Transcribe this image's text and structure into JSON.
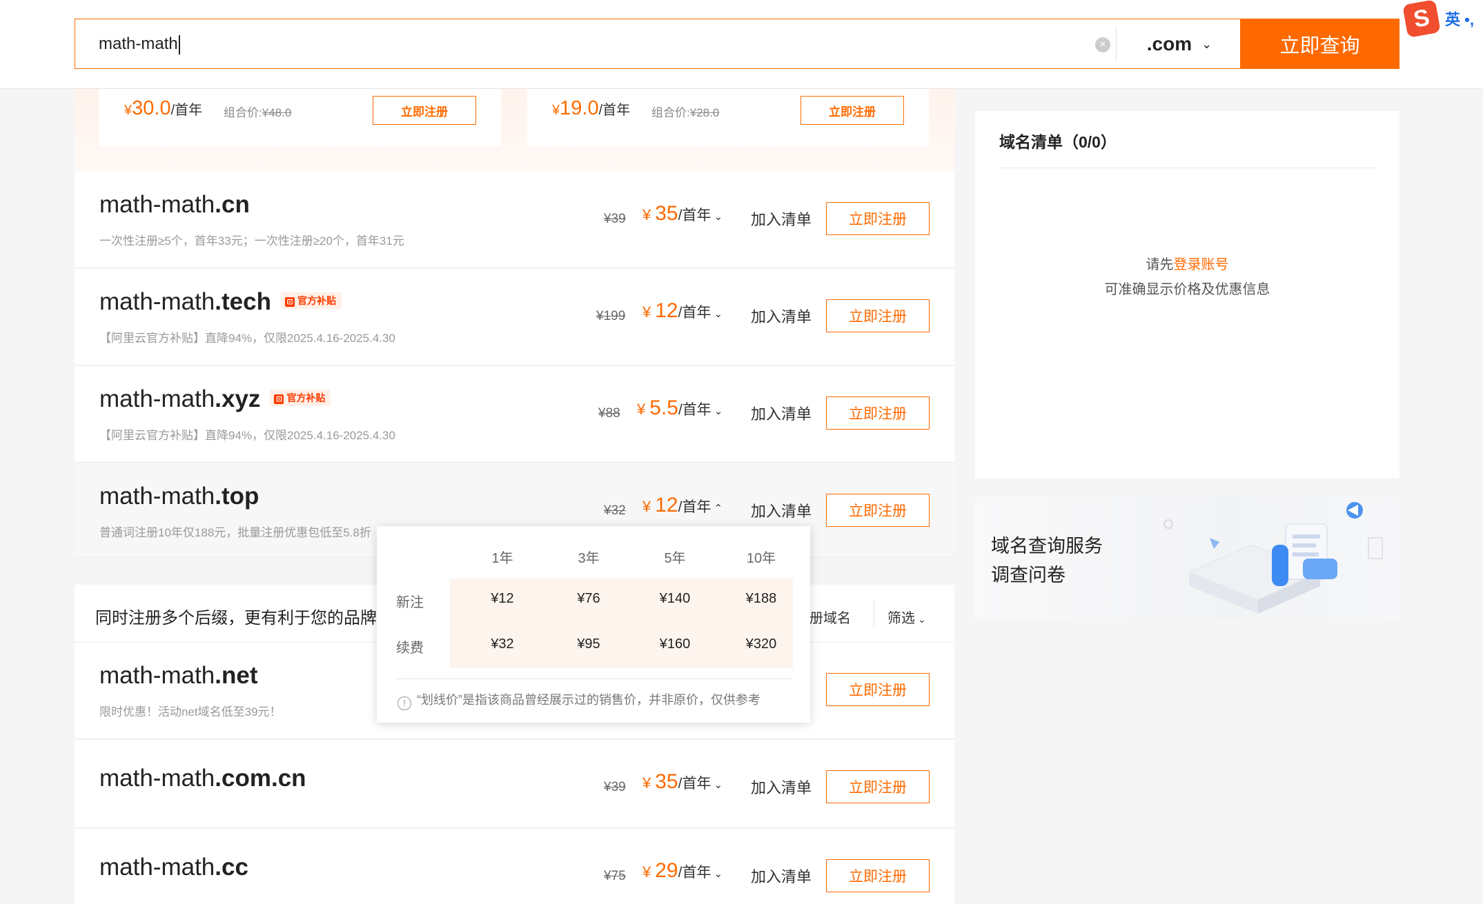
{
  "search": {
    "query": "math-math",
    "tld": ".com",
    "submit_label": "立即查询"
  },
  "ime": {
    "logo": "S",
    "mode": "英 •,"
  },
  "promo": [
    {
      "price_symbol": "¥",
      "price": "30.0",
      "unit": "/首年",
      "combo_label": "组合价:",
      "combo_orig": "¥48.0",
      "button": "立即注册"
    },
    {
      "price_symbol": "¥",
      "price": "19.0",
      "unit": "/首年",
      "combo_label": "组合价:",
      "combo_orig": "¥28.0",
      "button": "立即注册"
    }
  ],
  "domains": [
    {
      "base": "math-math",
      "tld": ".cn",
      "badge": "",
      "desc": "一次性注册≥5个，首年33元；一次性注册≥20个，首年31元",
      "orig_price": "¥39",
      "price_symbol": "¥",
      "price": "35",
      "unit": "/首年",
      "chevron": "⌄",
      "add_label": "加入清单",
      "register_label": "立即注册"
    },
    {
      "base": "math-math",
      "tld": ".tech",
      "badge": "官方补贴",
      "desc": "【阿里云官方补贴】直降94%，仅限2025.4.16-2025.4.30",
      "orig_price": "¥199",
      "price_symbol": "¥",
      "price": "12",
      "unit": "/首年",
      "chevron": "⌄",
      "add_label": "加入清单",
      "register_label": "立即注册"
    },
    {
      "base": "math-math",
      "tld": ".xyz",
      "badge": "官方补贴",
      "desc": "【阿里云官方补贴】直降94%，仅限2025.4.16-2025.4.30",
      "orig_price": "¥88",
      "price_symbol": "¥",
      "price": "5.5",
      "unit": "/首年",
      "chevron": "⌄",
      "add_label": "加入清单",
      "register_label": "立即注册"
    },
    {
      "base": "math-math",
      "tld": ".top",
      "badge": "",
      "desc": "普通词注册10年仅188元，批量注册优惠包低至5.8折",
      "orig_price": "¥32",
      "price_symbol": "¥",
      "price": "12",
      "unit": "/首年",
      "chevron": "⌃",
      "add_label": "加入清单",
      "register_label": "立即注册"
    }
  ],
  "multi": {
    "title": "同时注册多个后缀，更有利于您的品牌保护",
    "register_link": "册域名",
    "filter_label": "筛选"
  },
  "domains2": [
    {
      "base": "math-math",
      "tld": ".net",
      "desc": "限时优惠！活动net域名低至39元！",
      "register_label": "立即注册"
    },
    {
      "base": "math-math",
      "tld": ".com.cn",
      "desc": "",
      "orig_price": "¥39",
      "price_symbol": "¥",
      "price": "35",
      "unit": "/首年",
      "chevron": "⌄",
      "add_label": "加入清单",
      "register_label": "立即注册"
    },
    {
      "base": "math-math",
      "tld": ".cc",
      "desc": "",
      "orig_price": "¥75",
      "price_symbol": "¥",
      "price": "29",
      "unit": "/首年",
      "chevron": "⌄",
      "add_label": "加入清单",
      "register_label": "立即注册"
    }
  ],
  "price_popup": {
    "headers": [
      "1年",
      "3年",
      "5年",
      "10年"
    ],
    "rows": [
      {
        "label": "新注",
        "values": [
          "¥12",
          "¥76",
          "¥140",
          "¥188"
        ]
      },
      {
        "label": "续费",
        "values": [
          "¥32",
          "¥95",
          "¥160",
          "¥320"
        ]
      }
    ],
    "note": "“划线价”是指该商品曾经展示过的销售价，并非原价，仅供参考"
  },
  "cart": {
    "title": "域名清单（0/0）",
    "msg_prefix": "请先",
    "msg_link": "登录账号",
    "msg2": "可准确显示价格及优惠信息"
  },
  "survey": {
    "line1": "域名查询服务",
    "line2": "调查问卷"
  },
  "colors": {
    "accent": "#ff6a00",
    "ime": "#f04e2f",
    "ime_text": "#1c6ee6"
  }
}
